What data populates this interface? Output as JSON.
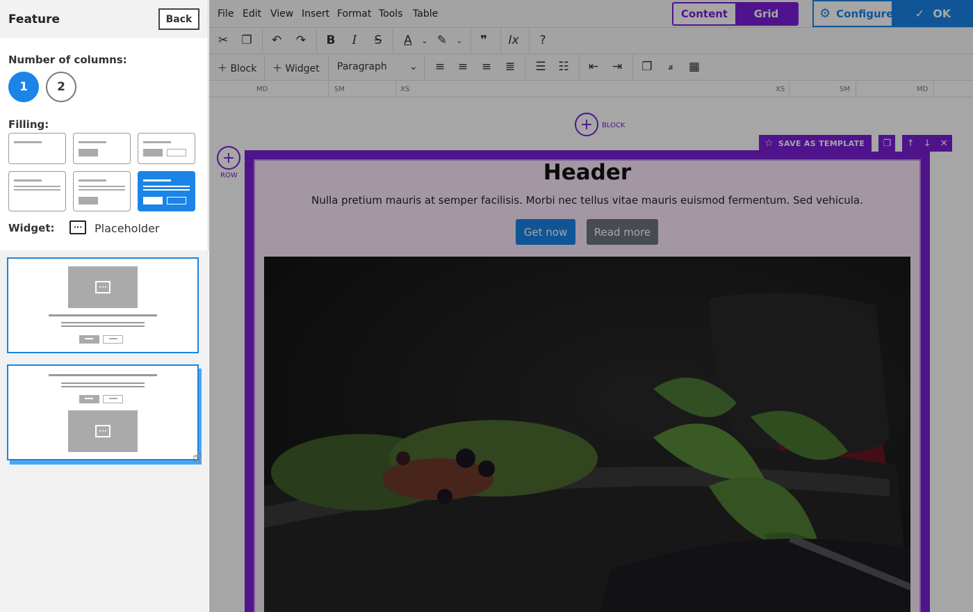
{
  "left_panel": {
    "title": "Feature",
    "back_label": "Back",
    "columns_label": "Number of columns:",
    "columns": [
      "1",
      "2"
    ],
    "selected_columns": "1",
    "filling_label": "Filling:",
    "widget_label": "Widget:",
    "widget_value": "Placeholder",
    "widget_icon": "ellipsis-box-icon"
  },
  "menubar": {
    "items": [
      "File",
      "Edit",
      "View",
      "Insert",
      "Format",
      "Tools",
      "Table"
    ],
    "toggle": {
      "content": "Content",
      "grid": "Grid",
      "active": "Grid"
    },
    "configure_label": "Configure",
    "ok_label": "OK"
  },
  "toolbar": {
    "block_label": "Block",
    "widget_label": "Widget",
    "paragraph_label": "Paragraph"
  },
  "ruler": {
    "labels": [
      "MD",
      "SM",
      "XS",
      "XS",
      "SM",
      "MD"
    ]
  },
  "canvas": {
    "block_label": "BLOCK",
    "row_label": "ROW",
    "save_template_label": "SAVE AS TEMPLATE",
    "header": "Header",
    "subtext": "Nulla pretium mauris at semper facilisis. Morbi nec tellus vitae mauris euismod fermentum. Sed vehicula.",
    "get_now_label": "Get now",
    "read_more_label": "Read more"
  },
  "colors": {
    "accent": "#1a84e8",
    "grid_purple": "#7a1fd6",
    "block_bg": "#fbe8fb"
  }
}
